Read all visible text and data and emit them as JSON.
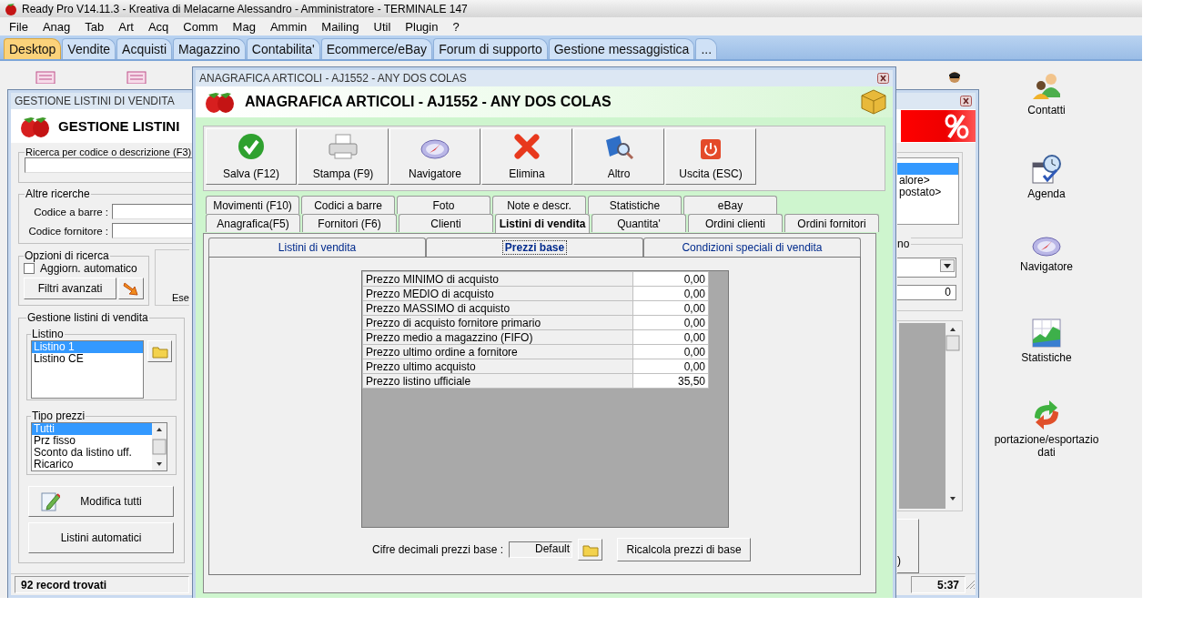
{
  "window": {
    "title": "Ready Pro V14.11.3 - Kreativa di Melacarne Alessandro - Amministratore - TERMINALE 147"
  },
  "menu": [
    "File",
    "Anag",
    "Tab",
    "Art",
    "Acq",
    "Comm",
    "Mag",
    "Ammin",
    "Mailing",
    "Util",
    "Plugin",
    "?"
  ],
  "tabs": [
    {
      "label": "Desktop",
      "selected": true
    },
    {
      "label": "Vendite",
      "selected": false
    },
    {
      "label": "Acquisti",
      "selected": false
    },
    {
      "label": "Magazzino",
      "selected": false
    },
    {
      "label": "Contabilita'",
      "selected": false
    },
    {
      "label": "Ecommerce/eBay",
      "selected": false
    },
    {
      "label": "Forum di supporto",
      "selected": false
    },
    {
      "label": "Gestione messaggistica",
      "selected": false
    },
    {
      "label": "...",
      "selected": false
    }
  ],
  "desktop_icons": [
    {
      "label": "Contatti"
    },
    {
      "label": "Agenda"
    },
    {
      "label": "Navigatore"
    },
    {
      "label": "Statistiche"
    },
    {
      "label": "portazione/esportazio dati"
    }
  ],
  "listini_window": {
    "title": "GESTIONE LISTINI DI VENDITA",
    "heading": "GESTIONE LISTINI",
    "search": {
      "label": "Ricerca per codice o descrizione (F3)"
    },
    "other_search": {
      "label": "Altre ricerche",
      "fields": [
        "Codice a barre :",
        "Codice fornitore :"
      ]
    },
    "options": {
      "label": "Opzioni di ricerca",
      "auto_update": {
        "label": "Aggiorn. automatico",
        "checked": false
      },
      "filter_button": "Filtri avanzati"
    },
    "partial_label": "Ese",
    "price_lists": {
      "label": "Gestione listini di vendita",
      "listino": {
        "label": "Listino",
        "items": [
          {
            "label": "Listino 1",
            "selected": true
          },
          {
            "label": "Listino CE",
            "selected": false
          }
        ]
      },
      "price_types": {
        "label": "Tipo prezzi",
        "items": [
          {
            "label": "Tutti",
            "selected": true
          },
          {
            "label": "Prz fisso",
            "selected": false
          },
          {
            "label": "Sconto da listino uff.",
            "selected": false
          },
          {
            "label": "Ricarico",
            "selected": false
          }
        ]
      },
      "buttons": [
        "Modifica tutti",
        "Listini automatici"
      ]
    },
    "status": "92 record trovati",
    "right_list": [
      {
        "selected": true
      },
      {
        "label": "alore>",
        "selected": false
      },
      {
        "label": "postato>",
        "selected": false
      }
    ],
    "right_group_label": "no",
    "right_field_value": "0",
    "right_button_text": ")",
    "status_time": "5:37"
  },
  "article_dialog": {
    "title": "ANAGRAFICA ARTICOLI - AJ1552 - ANY DOS COLAS",
    "heading": "ANAGRAFICA ARTICOLI - AJ1552 - ANY DOS COLAS",
    "toolbar": [
      "Salva (F12)",
      "Stampa (F9)",
      "Navigatore",
      "Elimina",
      "Altro",
      "Uscita (ESC)"
    ],
    "tabs_row1": [
      {
        "label": "Movimenti (F10)",
        "selected": false
      },
      {
        "label": "Codici a barre",
        "selected": false
      },
      {
        "label": "Foto",
        "selected": false
      },
      {
        "label": "Note e descr.",
        "selected": false
      },
      {
        "label": "Statistiche",
        "selected": false
      },
      {
        "label": "eBay",
        "selected": false
      }
    ],
    "tabs_row2": [
      {
        "label": "Anagrafica(F5)",
        "selected": false
      },
      {
        "label": "Fornitori (F6)",
        "selected": false
      },
      {
        "label": "Clienti",
        "selected": false
      },
      {
        "label": "Listini di vendita",
        "selected": true
      },
      {
        "label": "Quantita'",
        "selected": false
      },
      {
        "label": "Ordini clienti",
        "selected": false
      },
      {
        "label": "Ordini fornitori",
        "selected": false
      }
    ],
    "subtabs": [
      {
        "label": "Listini di vendita",
        "selected": false
      },
      {
        "label": "Prezzi base",
        "selected": true
      },
      {
        "label": "Condizioni speciali di vendita",
        "selected": false
      }
    ],
    "prices": [
      {
        "label": "Prezzo MINIMO di acquisto",
        "value": "0,00"
      },
      {
        "label": "Prezzo MEDIO di acquisto",
        "value": "0,00"
      },
      {
        "label": "Prezzo MASSIMO di acquisto",
        "value": "0,00"
      },
      {
        "label": "Prezzo di acquisto fornitore primario",
        "value": "0,00"
      },
      {
        "label": "Prezzo medio a magazzino (FIFO)",
        "value": "0,00"
      },
      {
        "label": "Prezzo ultimo ordine a fornitore",
        "value": "0,00"
      },
      {
        "label": "Prezzo ultimo acquisto",
        "value": "0,00"
      },
      {
        "label": "Prezzo listino ufficiale",
        "value": "35,50"
      }
    ],
    "decimals": {
      "label": "Cifre decimali prezzi base :",
      "value": "Default"
    },
    "recalc_button": "Ricalcola prezzi di base"
  }
}
